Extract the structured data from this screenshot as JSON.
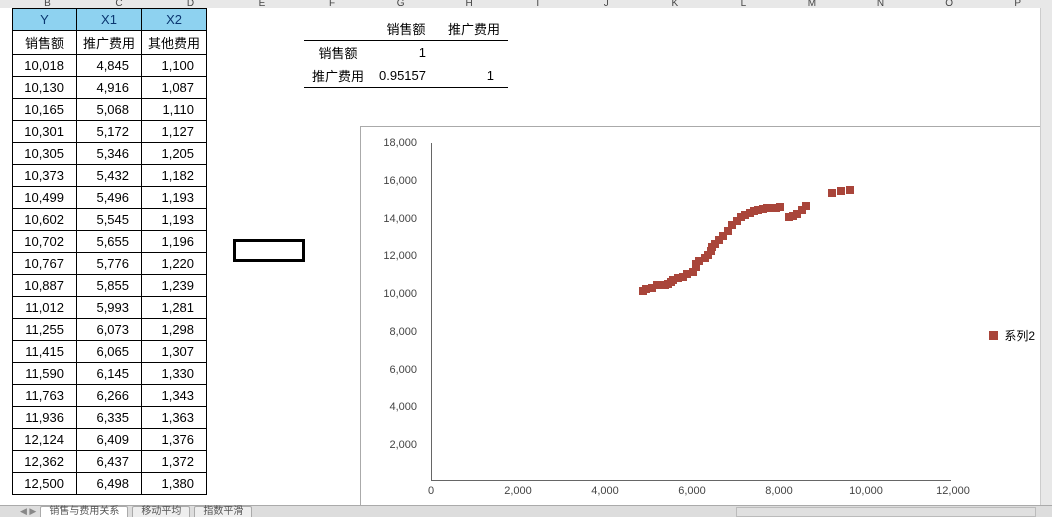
{
  "columns": [
    "B",
    "C",
    "D",
    "E",
    "F",
    "G",
    "H",
    "I",
    "J",
    "K",
    "L",
    "M",
    "N",
    "O",
    "P"
  ],
  "table": {
    "top_headers": [
      "Y",
      "X1",
      "X2"
    ],
    "sub_headers": [
      "销售额",
      "推广费用",
      "其他费用"
    ],
    "rows": [
      [
        "10,018",
        "4,845",
        "1,100"
      ],
      [
        "10,130",
        "4,916",
        "1,087"
      ],
      [
        "10,165",
        "5,068",
        "1,110"
      ],
      [
        "10,301",
        "5,172",
        "1,127"
      ],
      [
        "10,305",
        "5,346",
        "1,205"
      ],
      [
        "10,373",
        "5,432",
        "1,182"
      ],
      [
        "10,499",
        "5,496",
        "1,193"
      ],
      [
        "10,602",
        "5,545",
        "1,193"
      ],
      [
        "10,702",
        "5,655",
        "1,196"
      ],
      [
        "10,767",
        "5,776",
        "1,220"
      ],
      [
        "10,887",
        "5,855",
        "1,239"
      ],
      [
        "11,012",
        "5,993",
        "1,281"
      ],
      [
        "11,255",
        "6,073",
        "1,298"
      ],
      [
        "11,415",
        "6,065",
        "1,307"
      ],
      [
        "11,590",
        "6,145",
        "1,330"
      ],
      [
        "11,763",
        "6,266",
        "1,343"
      ],
      [
        "11,936",
        "6,335",
        "1,363"
      ],
      [
        "12,124",
        "6,409",
        "1,376"
      ],
      [
        "12,362",
        "6,437",
        "1,372"
      ],
      [
        "12,500",
        "6,498",
        "1,380"
      ]
    ]
  },
  "corr": {
    "col_headers": [
      "销售额",
      "推广费用"
    ],
    "rows": [
      {
        "label": "销售额",
        "v": [
          "1",
          ""
        ]
      },
      {
        "label": "推广费用",
        "v": [
          "0.95157",
          "1"
        ]
      }
    ]
  },
  "chart_data": {
    "type": "scatter",
    "series": [
      {
        "name": "系列2",
        "points": [
          [
            4845,
            10018
          ],
          [
            4916,
            10130
          ],
          [
            5068,
            10165
          ],
          [
            5172,
            10301
          ],
          [
            5346,
            10305
          ],
          [
            5432,
            10373
          ],
          [
            5496,
            10499
          ],
          [
            5545,
            10602
          ],
          [
            5655,
            10702
          ],
          [
            5776,
            10767
          ],
          [
            5855,
            10887
          ],
          [
            5993,
            11012
          ],
          [
            6073,
            11255
          ],
          [
            6065,
            11415
          ],
          [
            6145,
            11590
          ],
          [
            6266,
            11763
          ],
          [
            6335,
            11936
          ],
          [
            6409,
            12124
          ],
          [
            6437,
            12362
          ],
          [
            6498,
            12500
          ],
          [
            6600,
            12700
          ],
          [
            6700,
            12900
          ],
          [
            6800,
            13200
          ],
          [
            6900,
            13500
          ],
          [
            7000,
            13700
          ],
          [
            7100,
            13900
          ],
          [
            7200,
            14050
          ],
          [
            7300,
            14150
          ],
          [
            7400,
            14250
          ],
          [
            7500,
            14300
          ],
          [
            7600,
            14350
          ],
          [
            7700,
            14380
          ],
          [
            7800,
            14400
          ],
          [
            7900,
            14420
          ],
          [
            8000,
            14440
          ],
          [
            8200,
            13900
          ],
          [
            8300,
            14000
          ],
          [
            8400,
            14100
          ],
          [
            8500,
            14300
          ],
          [
            8600,
            14500
          ],
          [
            9200,
            15200
          ],
          [
            9400,
            15300
          ],
          [
            9600,
            15350
          ]
        ]
      }
    ],
    "xlim": [
      0,
      12000
    ],
    "ylim": [
      0,
      18000
    ],
    "x_ticks": [
      0,
      2000,
      4000,
      6000,
      8000,
      10000,
      12000
    ],
    "y_ticks": [
      2000,
      4000,
      6000,
      8000,
      10000,
      12000,
      14000,
      16000,
      18000
    ],
    "x_tick_labels": [
      "0",
      "2,000",
      "4,000",
      "6,000",
      "8,000",
      "10,000",
      "12,000"
    ],
    "y_tick_labels": [
      "2,000",
      "4,000",
      "6,000",
      "8,000",
      "10,000",
      "12,000",
      "14,000",
      "16,000",
      "18,000"
    ]
  },
  "legend_label": "系列2",
  "tabs": [
    "销售与费用关系",
    "移动平均",
    "指数平滑"
  ]
}
